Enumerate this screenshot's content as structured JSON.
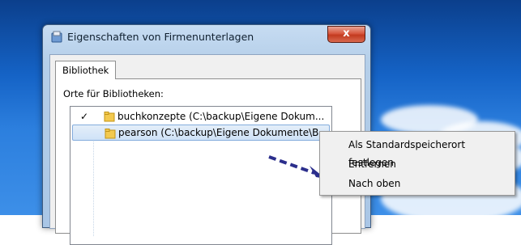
{
  "window": {
    "title": "Eigenschaften von Firmenunterlagen",
    "close_label": "x"
  },
  "tabs": [
    {
      "label": "Bibliothek"
    }
  ],
  "panel": {
    "section_label": "Orte für Bibliotheken:",
    "locations": [
      {
        "check": "✓",
        "text": "buchkonzepte (C:\\backup\\Eigene Dokum..."
      },
      {
        "check": "",
        "text": "pearson (C:\\backup\\Eigene Dokumente\\B..."
      }
    ]
  },
  "context_menu": {
    "items": [
      {
        "label": "Als Standardspeicherort festlegen"
      },
      {
        "label": "Entfernen"
      },
      {
        "label": "Nach oben"
      }
    ]
  },
  "colors": {
    "desktop_blue": "#1563c6",
    "arrow": "#2b2e8c",
    "selection": "#cfe2f7"
  },
  "icons": [
    "library-icon",
    "close-icon",
    "check-icon",
    "folder-icon",
    "pointer-arrow-icon"
  ]
}
